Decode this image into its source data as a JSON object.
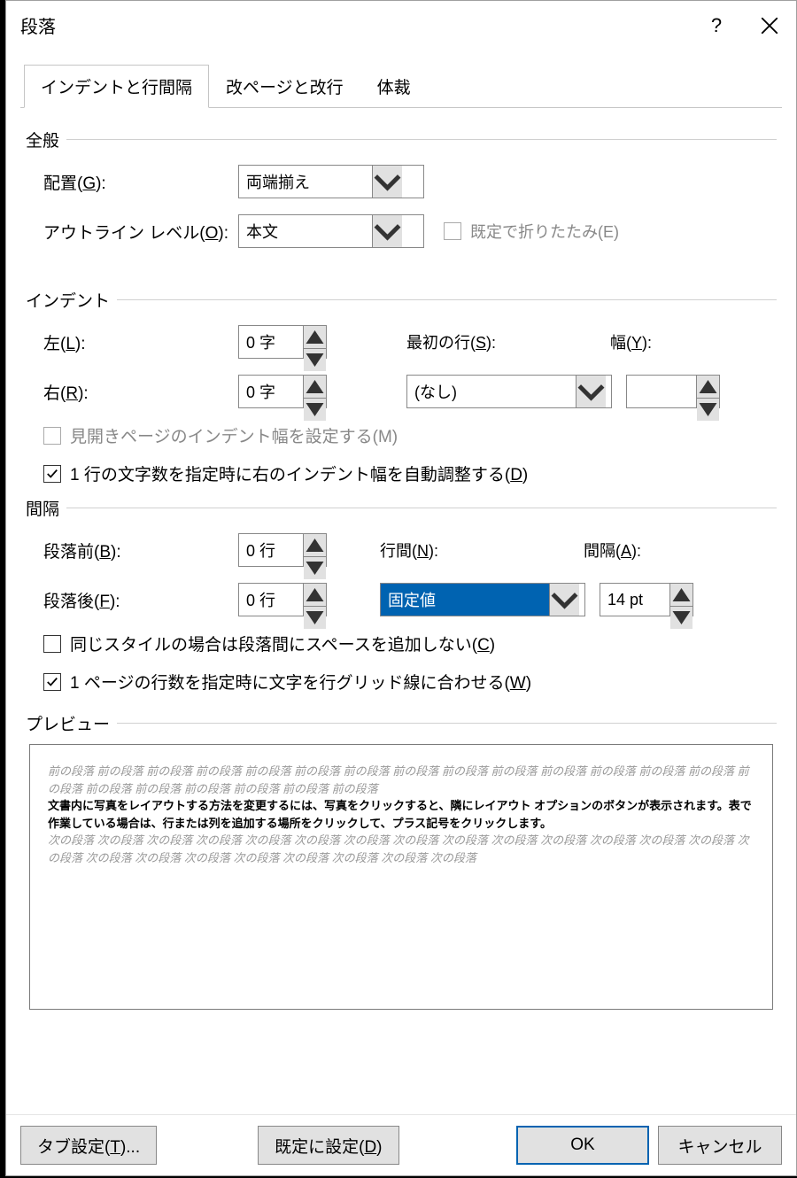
{
  "title": "段落",
  "tabs": {
    "indent_spacing": "インデントと行間隔",
    "page_break": "改ページと改行",
    "format": "体裁"
  },
  "sections": {
    "general": "全般",
    "indent": "インデント",
    "spacing": "間隔",
    "preview": "プレビュー"
  },
  "general": {
    "alignment_label": "配置(G):",
    "alignment_value": "両端揃え",
    "outline_label": "アウトライン レベル(O):",
    "outline_value": "本文",
    "collapse_label": "既定で折りたたみ(E)",
    "collapse_checked": false
  },
  "indent": {
    "left_label": "左(L):",
    "left_value": "0 字",
    "right_label": "右(R):",
    "right_value": "0 字",
    "firstline_label": "最初の行(S):",
    "firstline_value": "(なし)",
    "width_label": "幅(Y):",
    "width_value": "",
    "mirror_label": "見開きページのインデント幅を設定する(M)",
    "mirror_checked": false,
    "auto_label": "1 行の文字数を指定時に右のインデント幅を自動調整する(D)",
    "auto_checked": true
  },
  "spacing": {
    "before_label": "段落前(B):",
    "before_value": "0 行",
    "after_label": "段落後(F):",
    "after_value": "0 行",
    "line_label": "行間(N):",
    "line_value": "固定値",
    "interval_label": "間隔(A):",
    "interval_value": "14 pt",
    "nospace_label": "同じスタイルの場合は段落間にスペースを追加しない(C)",
    "nospace_checked": false,
    "grid_label": "1 ページの行数を指定時に文字を行グリッド線に合わせる(W)",
    "grid_checked": true
  },
  "preview": {
    "before_text": "前の段落 前の段落 前の段落 前の段落 前の段落 前の段落 前の段落 前の段落 前の段落 前の段落 前の段落 前の段落 前の段落 前の段落 前の段落 前の段落 前の段落 前の段落 前の段落 前の段落 前の段落",
    "sample_text": "文書内に写真をレイアウトする方法を変更するには、写真をクリックすると、隣にレイアウト オプションのボタンが表示されます。表で作業している場合は、行または列を追加する場所をクリックして、プラス記号をクリックします。",
    "after_text": "次の段落 次の段落 次の段落 次の段落 次の段落 次の段落 次の段落 次の段落 次の段落 次の段落 次の段落 次の段落 次の段落 次の段落 次の段落 次の段落 次の段落 次の段落 次の段落 次の段落 次の段落 次の段落 次の段落"
  },
  "footer": {
    "tabs_btn": "タブ設定(T)...",
    "default_btn": "既定に設定(D)",
    "ok_btn": "OK",
    "cancel_btn": "キャンセル"
  }
}
